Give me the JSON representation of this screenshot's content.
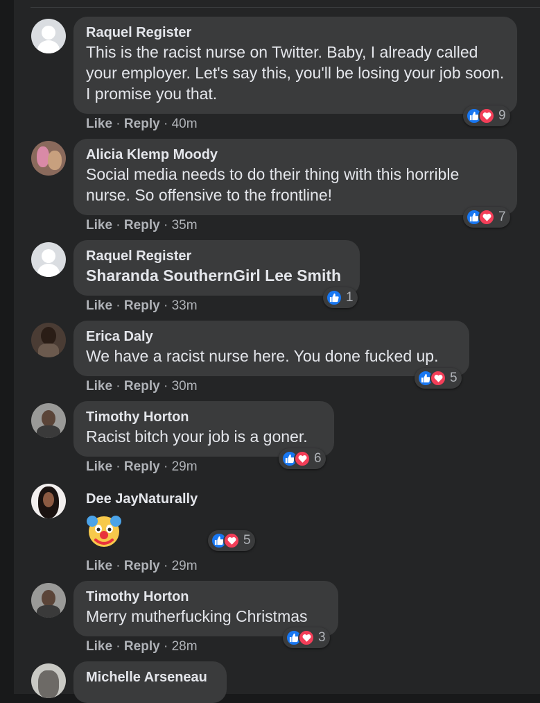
{
  "comments": [
    {
      "author": "Raquel Register",
      "text": "This is the racist nurse on Twitter. Baby, I already called your employer. Let's say this, you'll be losing your job soon. I promise you that.",
      "like": "Like",
      "reply": "Reply",
      "time": "40m",
      "reactions": "9"
    },
    {
      "author": "Alicia Klemp Moody",
      "text": "Social media needs to do their thing with this horrible nurse. So offensive to the frontline!",
      "like": "Like",
      "reply": "Reply",
      "time": "35m",
      "reactions": "7"
    },
    {
      "author": "Raquel Register",
      "text": "Sharanda SouthernGirl Lee Smith",
      "like": "Like",
      "reply": "Reply",
      "time": "33m",
      "reactions": "1"
    },
    {
      "author": "Erica Daly",
      "text": "We have a racist nurse here. You done fucked up.",
      "like": "Like",
      "reply": "Reply",
      "time": "30m",
      "reactions": "5"
    },
    {
      "author": "Timothy Horton",
      "text": "Racist bitch your job is a goner.",
      "like": "Like",
      "reply": "Reply",
      "time": "29m",
      "reactions": "6"
    },
    {
      "author": "Dee JayNaturally",
      "text": "",
      "emoji": "clown-face",
      "like": "Like",
      "reply": "Reply",
      "time": "29m",
      "reactions": "5"
    },
    {
      "author": "Timothy Horton",
      "text": "Merry mutherfucking Christmas",
      "like": "Like",
      "reply": "Reply",
      "time": "28m",
      "reactions": "3"
    },
    {
      "author": "Michelle Arseneau",
      "text": ""
    }
  ],
  "colors": {
    "background": "#242526",
    "bubble": "#3a3b3c",
    "like": "#1877f2",
    "love": "#f33e58"
  }
}
